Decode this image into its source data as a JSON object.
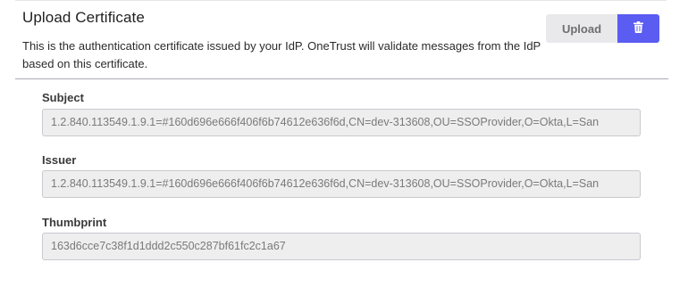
{
  "header": {
    "title": "Upload Certificate",
    "description": "This is the authentication certificate issued by your IdP. OneTrust will validate messages from the IdP based on this certificate.",
    "upload_label": "Upload",
    "delete_icon": "trash-icon"
  },
  "fields": {
    "subject": {
      "label": "Subject",
      "value": "1.2.840.113549.1.9.1=#160d696e666f406f6b74612e636f6d,CN=dev-313608,OU=SSOProvider,O=Okta,L=San"
    },
    "issuer": {
      "label": "Issuer",
      "value": "1.2.840.113549.1.9.1=#160d696e666f406f6b74612e636f6d,CN=dev-313608,OU=SSOProvider,O=Okta,L=San"
    },
    "thumbprint": {
      "label": "Thumbprint",
      "value": "163d6cce7c38f1d1ddd2c550c287bf61fc2c1a67"
    }
  },
  "colors": {
    "accent": "#5b5cf2",
    "upload_bg": "#e9e9ec",
    "field_bg": "#eeeeee",
    "divider": "#a9a9b3"
  }
}
